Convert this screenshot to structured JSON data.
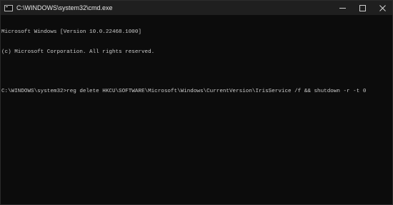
{
  "window": {
    "title": "C:\\WINDOWS\\system32\\cmd.exe"
  },
  "console": {
    "lines": [
      "Microsoft Windows [Version 10.0.22468.1000]",
      "(c) Microsoft Corporation. All rights reserved.",
      "",
      "C:\\WINDOWS\\system32>reg delete HKCU\\SOFTWARE\\Microsoft\\Windows\\CurrentVersion\\IrisService /f && shutdown -r -t 0"
    ]
  },
  "colors": {
    "background": "#0c0c0c",
    "text": "#cccccc",
    "titlebar": "#1f1f1f"
  },
  "icons": {
    "app": "cmd-app-icon",
    "minimize": "minimize-icon",
    "maximize": "maximize-icon",
    "close": "close-icon"
  }
}
